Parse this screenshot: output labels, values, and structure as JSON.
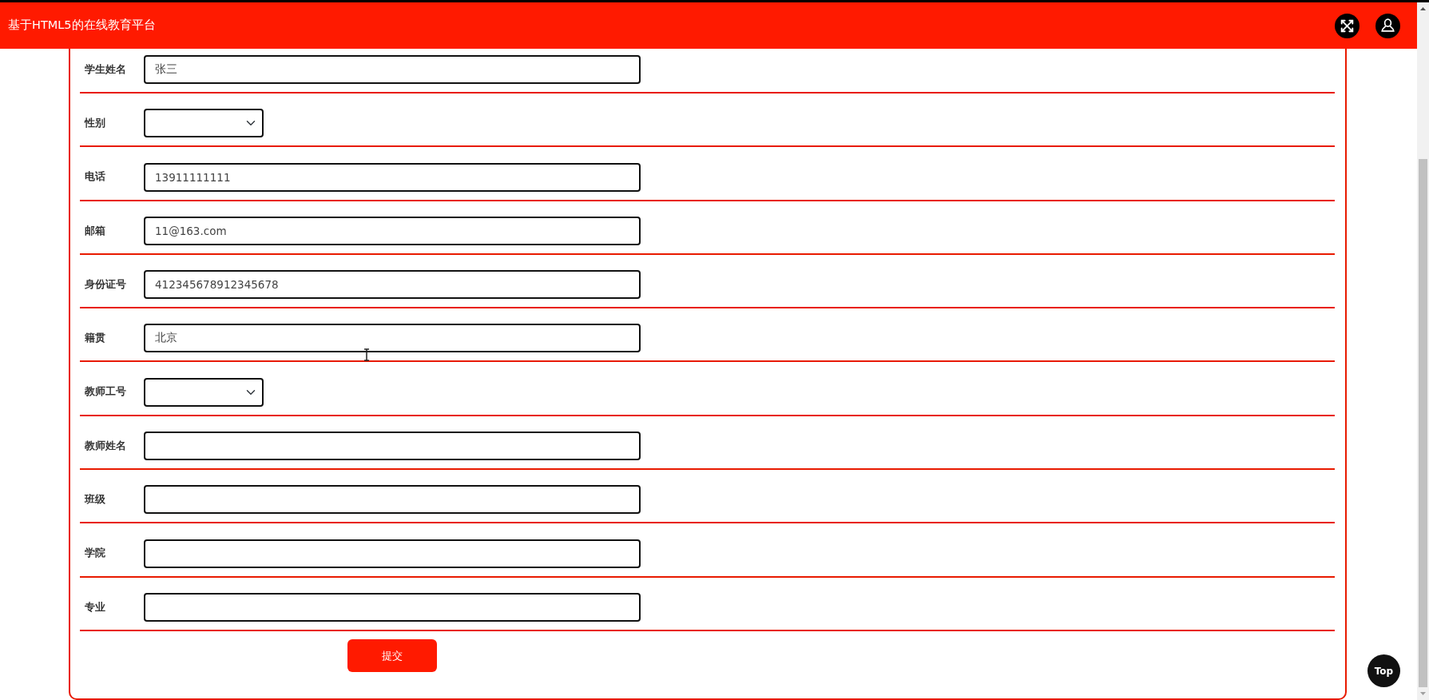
{
  "header": {
    "title": "基于HTML5的在线教育平台"
  },
  "form": {
    "fields": [
      {
        "label": "学生姓名",
        "kind": "text",
        "value": "张三"
      },
      {
        "label": "性别",
        "kind": "select"
      },
      {
        "label": "电话",
        "kind": "text",
        "value": "13911111111"
      },
      {
        "label": "邮箱",
        "kind": "text",
        "value": "11@163.com"
      },
      {
        "label": "身份证号",
        "kind": "text",
        "value": "412345678912345678"
      },
      {
        "label": "籍贯",
        "kind": "text",
        "value": "北京"
      },
      {
        "label": "教师工号",
        "kind": "select"
      },
      {
        "label": "教师姓名",
        "kind": "text"
      },
      {
        "label": "班级",
        "kind": "text"
      },
      {
        "label": "学院",
        "kind": "text"
      },
      {
        "label": "专业",
        "kind": "text"
      }
    ],
    "submit_button": "提交"
  },
  "back_to_top": "Top"
}
